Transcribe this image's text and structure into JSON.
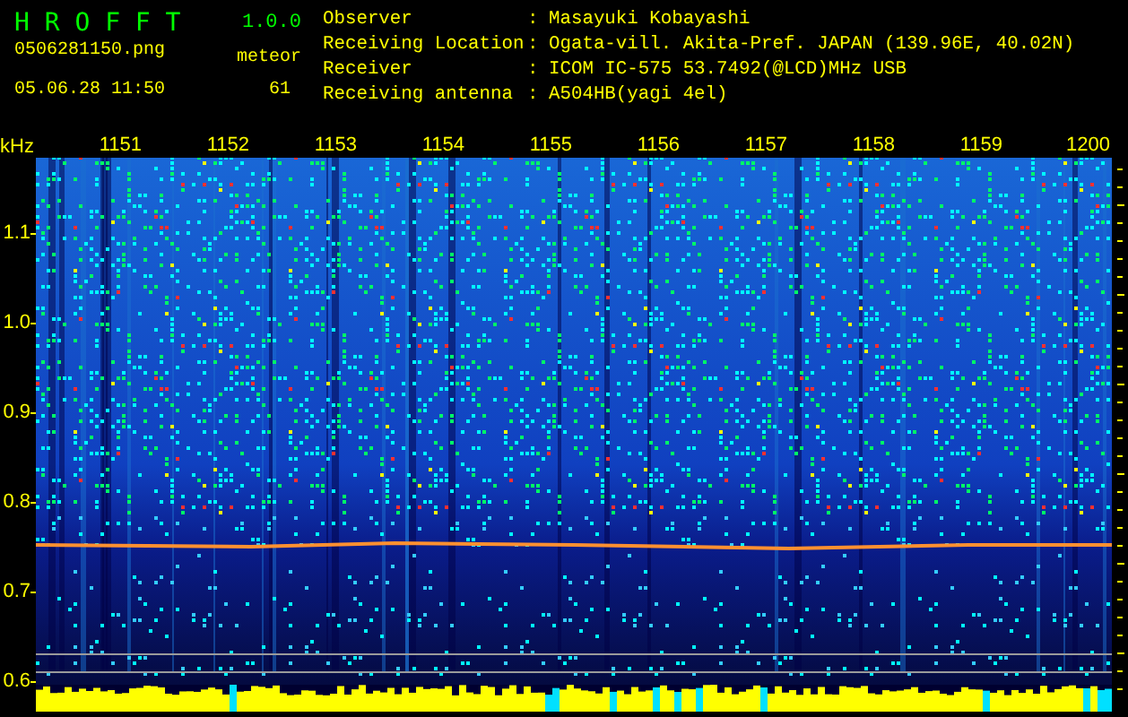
{
  "app": {
    "title": "H R O F F T",
    "version": "1.0.0"
  },
  "file": {
    "name": "0506281150.png",
    "datetime": "05.06.28 11:50"
  },
  "counter": {
    "label": "meteor",
    "value": "61"
  },
  "info": [
    {
      "label": "Observer",
      "value": "Masayuki Kobayashi"
    },
    {
      "label": "Receiving Location",
      "value": "Ogata-vill. Akita-Pref. JAPAN (139.96E, 40.02N)"
    },
    {
      "label": "Receiver",
      "value": "ICOM IC-575 53.7492(@LCD)MHz USB"
    },
    {
      "label": "Receiving antenna",
      "value": "A504HB(yagi 4el)"
    }
  ],
  "info_separator": ":",
  "y_axis": {
    "unit": "kHz",
    "ticks": [
      "1.1",
      "1.0",
      "0.9",
      "0.8",
      "0.7",
      "0.6"
    ]
  },
  "time_labels": [
    "1151",
    "1152",
    "1153",
    "1154",
    "1155",
    "1156",
    "1157",
    "1158",
    "1159",
    "1200"
  ]
}
